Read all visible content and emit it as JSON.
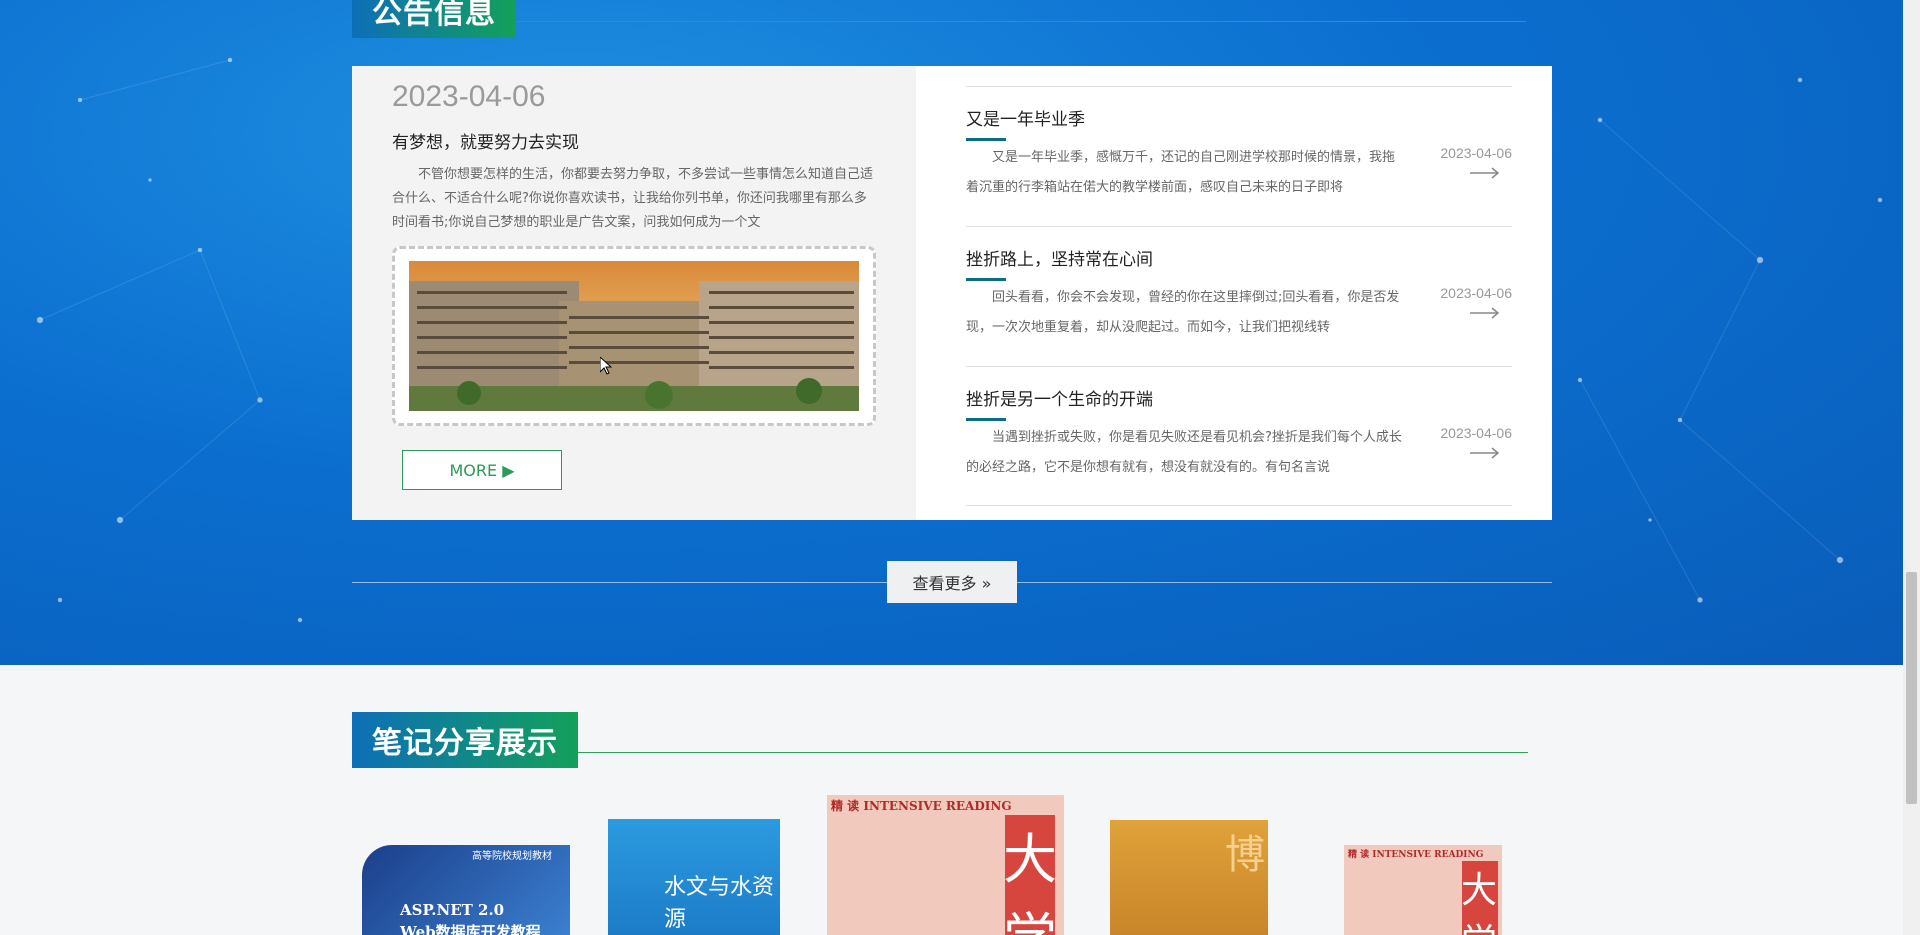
{
  "notice_section": {
    "title": "公告信息",
    "featured": {
      "date": "2023-04-06",
      "title": "有梦想，就要努力去实现",
      "text": "不管你想要怎样的生活，你都要去努力争取，不多尝试一些事情怎么知道自己适合什么、不适合什么呢?你说你喜欢读书，让我给你列书单，你还问我哪里有那么多时间看书;你说自己梦想的职业是广告文案，问我如何成为一个文",
      "more_label": "MORE ▶"
    },
    "items": [
      {
        "title": "又是一年毕业季",
        "text": "又是一年毕业季，感慨万千，还记的自己刚进学校那时候的情景，我拖着沉重的行李箱站在偌大的教学楼前面，感叹自己未来的日子即将",
        "date": "2023-04-06"
      },
      {
        "title": "挫折路上，坚持常在心间",
        "text": "回头看看，你会不会发现，曾经的你在这里摔倒过;回头看看，你是否发现，一次次地重复着，却从没爬起过。而如今，让我们把视线转",
        "date": "2023-04-06"
      },
      {
        "title": "挫折是另一个生命的开端",
        "text": "当遇到挫折或失败，你是看见失败还是看见机会?挫折是我们每个人成长的必经之路，它不是你想有就有，想没有就没有的。有句名言说",
        "date": "2023-04-06"
      }
    ],
    "view_more_label": "查看更多 »"
  },
  "notes_section": {
    "title": "笔记分享展示",
    "books": [
      {
        "lines": [
          "高等院校规划教材",
          "ASP.NET 2.0",
          "Web数据库开发教程"
        ],
        "color": "#1e4f9c"
      },
      {
        "lines": [
          "水文与水资源"
        ],
        "color": "#2a8fd6"
      },
      {
        "lines": [
          "精  读  INTENSIVE  READING",
          "大学"
        ],
        "color": "#f0c4b8"
      },
      {
        "lines": [
          "博"
        ],
        "color": "#d9962e"
      },
      {
        "lines": [
          "精  读  INTENSIVE  READING",
          "大学"
        ],
        "color": "#f0c4b8"
      }
    ]
  },
  "colors": {
    "accent_green": "#2c9a58",
    "band_blue": "#0b6fd0",
    "bar_teal": "#0b6d80"
  }
}
